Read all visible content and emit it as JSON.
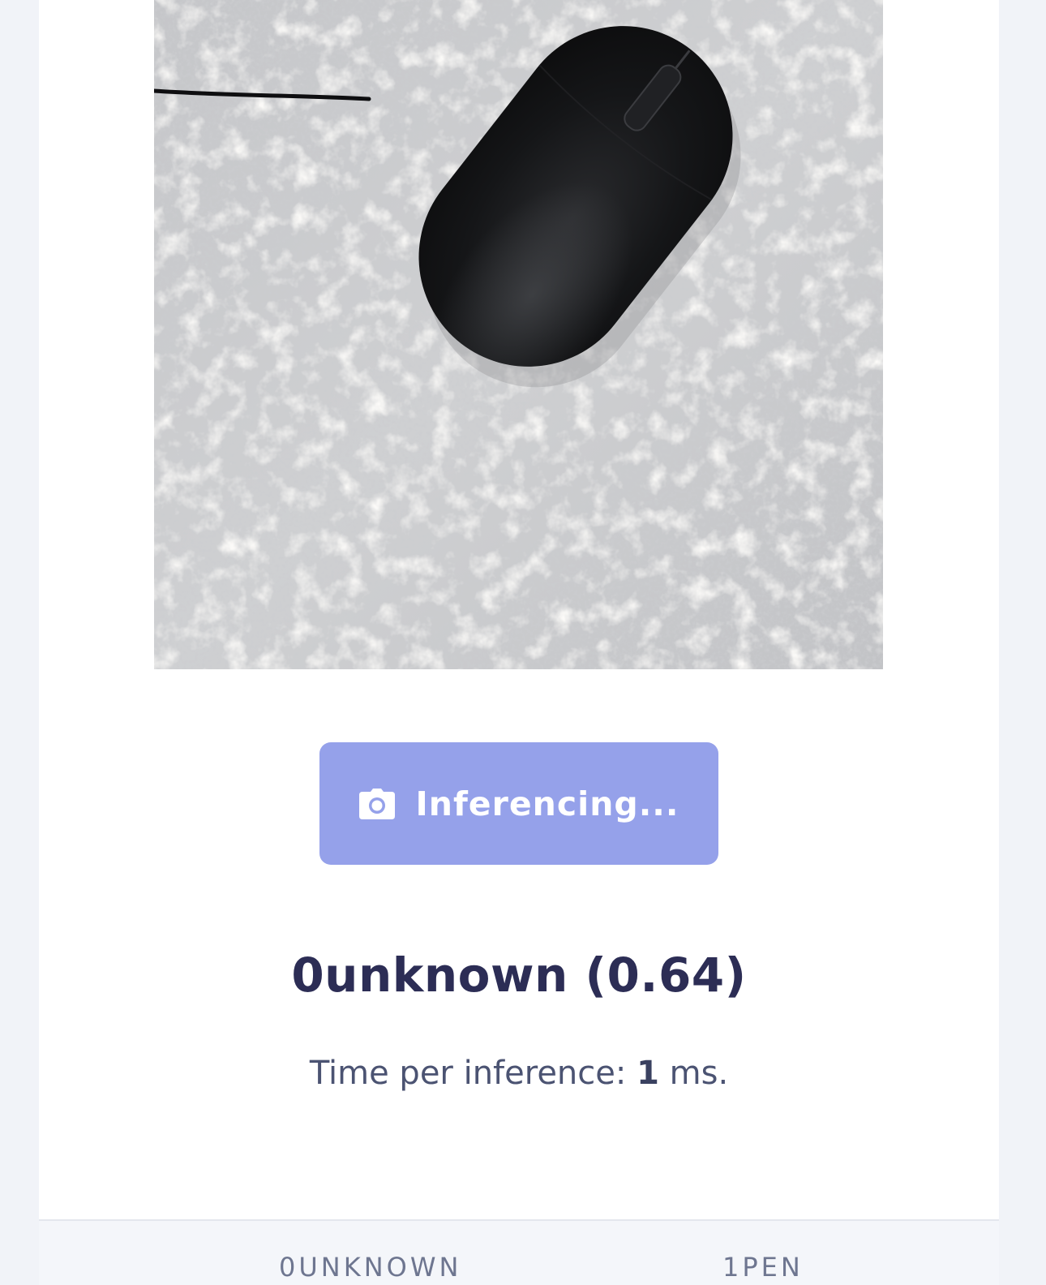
{
  "camera": {
    "image_alt": "Captured camera frame"
  },
  "inference_button": {
    "label": "Inferencing...",
    "icon": "camera-icon",
    "color": "#95a1ea"
  },
  "prediction": {
    "text": "0unknown (0.64)",
    "label": "0unknown",
    "confidence": 0.64
  },
  "timing": {
    "prefix": "Time per inference: ",
    "value": "1",
    "suffix": " ms."
  },
  "table": {
    "columns": [
      "0UNKNOWN",
      "1PEN"
    ]
  },
  "colors": {
    "heading": "#2c2d55",
    "body_text": "#4b5372",
    "page_bg": "#f1f3f8"
  }
}
